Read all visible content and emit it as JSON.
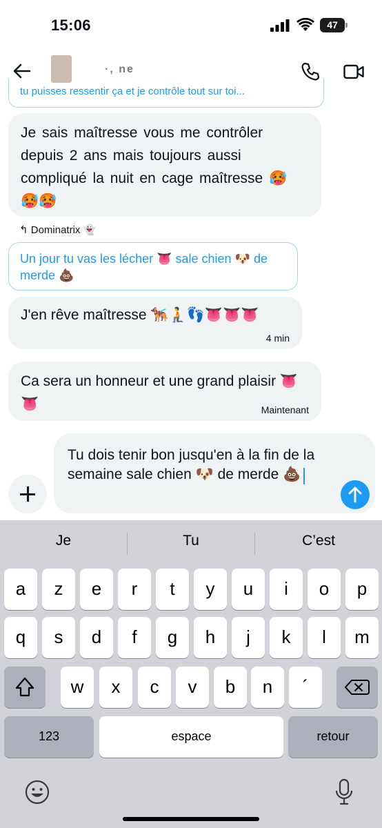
{
  "status_bar": {
    "time": "15:06",
    "battery": "47",
    "battery_level_percent": 47
  },
  "header": {
    "contact_name": "·, ne"
  },
  "messages": {
    "quoted_top": "tu puisses ressentir ça et je contrôle tout sur toi...",
    "msg1": "Je sais maîtresse vous me contrôler depuis 2 ans mais toujours aussi compliqué la nuit en cage maîtresse 🥵 🥵🥵",
    "reply_label": "Dominatrix 👻",
    "quoted_mid": "Un jour tu vas les lécher 👅 sale chien 🐶 de merde 💩",
    "msg2": "J'en rêve maîtresse 🐕‍🦺🧎👣👅👅👅",
    "msg2_time": "4 min",
    "msg3": "Ca sera un honneur et une grand plaisir 👅👅",
    "msg3_time": "Maintenant"
  },
  "composer": {
    "text": "Tu dois tenir bon jusqu'en à la fin de la semaine sale chien 🐶 de merde 💩"
  },
  "keyboard": {
    "suggestions": [
      "Je",
      "Tu",
      "C’est"
    ],
    "row1": [
      "a",
      "z",
      "e",
      "r",
      "t",
      "y",
      "u",
      "i",
      "o",
      "p"
    ],
    "row2": [
      "q",
      "s",
      "d",
      "f",
      "g",
      "h",
      "j",
      "k",
      "l",
      "m"
    ],
    "row3": [
      "w",
      "x",
      "c",
      "v",
      "b",
      "n",
      "´"
    ],
    "numbers_label": "123",
    "space_label": "espace",
    "return_label": "retour"
  },
  "colors": {
    "accent": "#1d9bf0",
    "bubble": "#eff3f4",
    "keyboard_bg": "#d1d3d9"
  }
}
